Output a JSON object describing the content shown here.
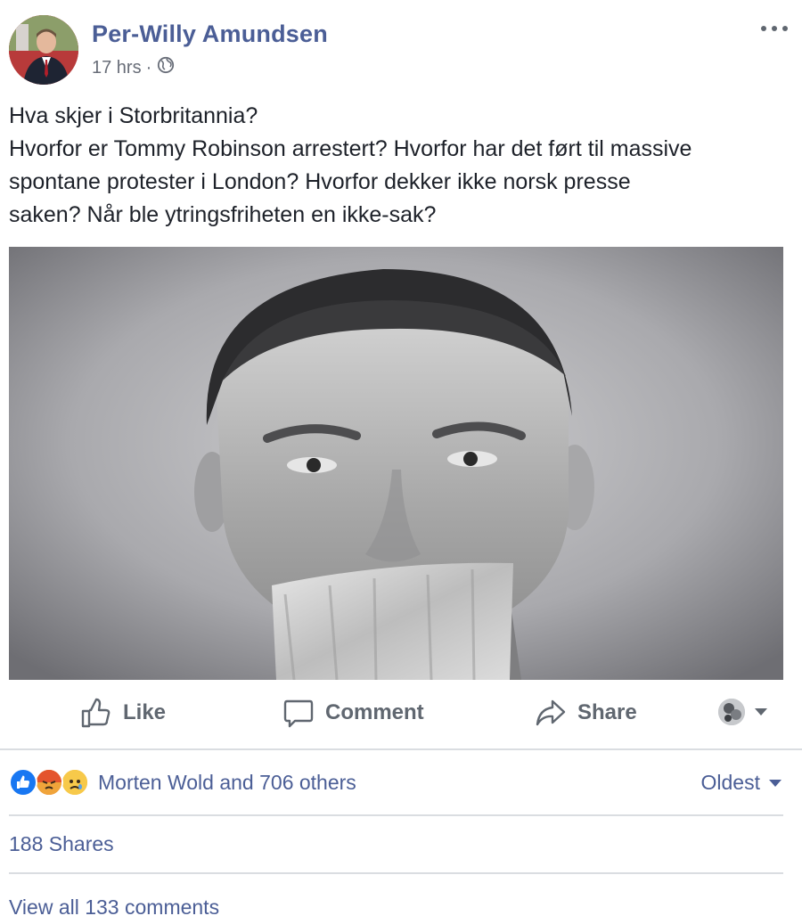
{
  "post": {
    "author": "Per-Willy Amundsen",
    "time": "17 hrs",
    "separator": "·",
    "privacy_icon": "globe-icon",
    "more_icon": "more-options-icon",
    "text_lines": [
      "Hva skjer i Storbritannia?",
      "Hvorfor er Tommy Robinson arrestert? Hvorfor har det ført til massive",
      "spontane protester i London? Hvorfor dekker ikke norsk presse",
      "saken? Når ble ytringsfriheten en ikke-sak?"
    ]
  },
  "actions": {
    "like": "Like",
    "comment": "Comment",
    "share": "Share"
  },
  "reactions": {
    "icons": [
      "like-reaction-icon",
      "angry-reaction-icon",
      "sad-reaction-icon"
    ],
    "summary": "Morten Wold and 706 others",
    "sort_label": "Oldest"
  },
  "shares": "188 Shares",
  "view_comments": "View all 133 comments",
  "colors": {
    "link": "#4b5e96",
    "text": "#1d2129",
    "muted": "#606770",
    "like_blue": "#1877f2",
    "reaction_yellow": "#f7b928",
    "angry_red": "#e9710f"
  }
}
